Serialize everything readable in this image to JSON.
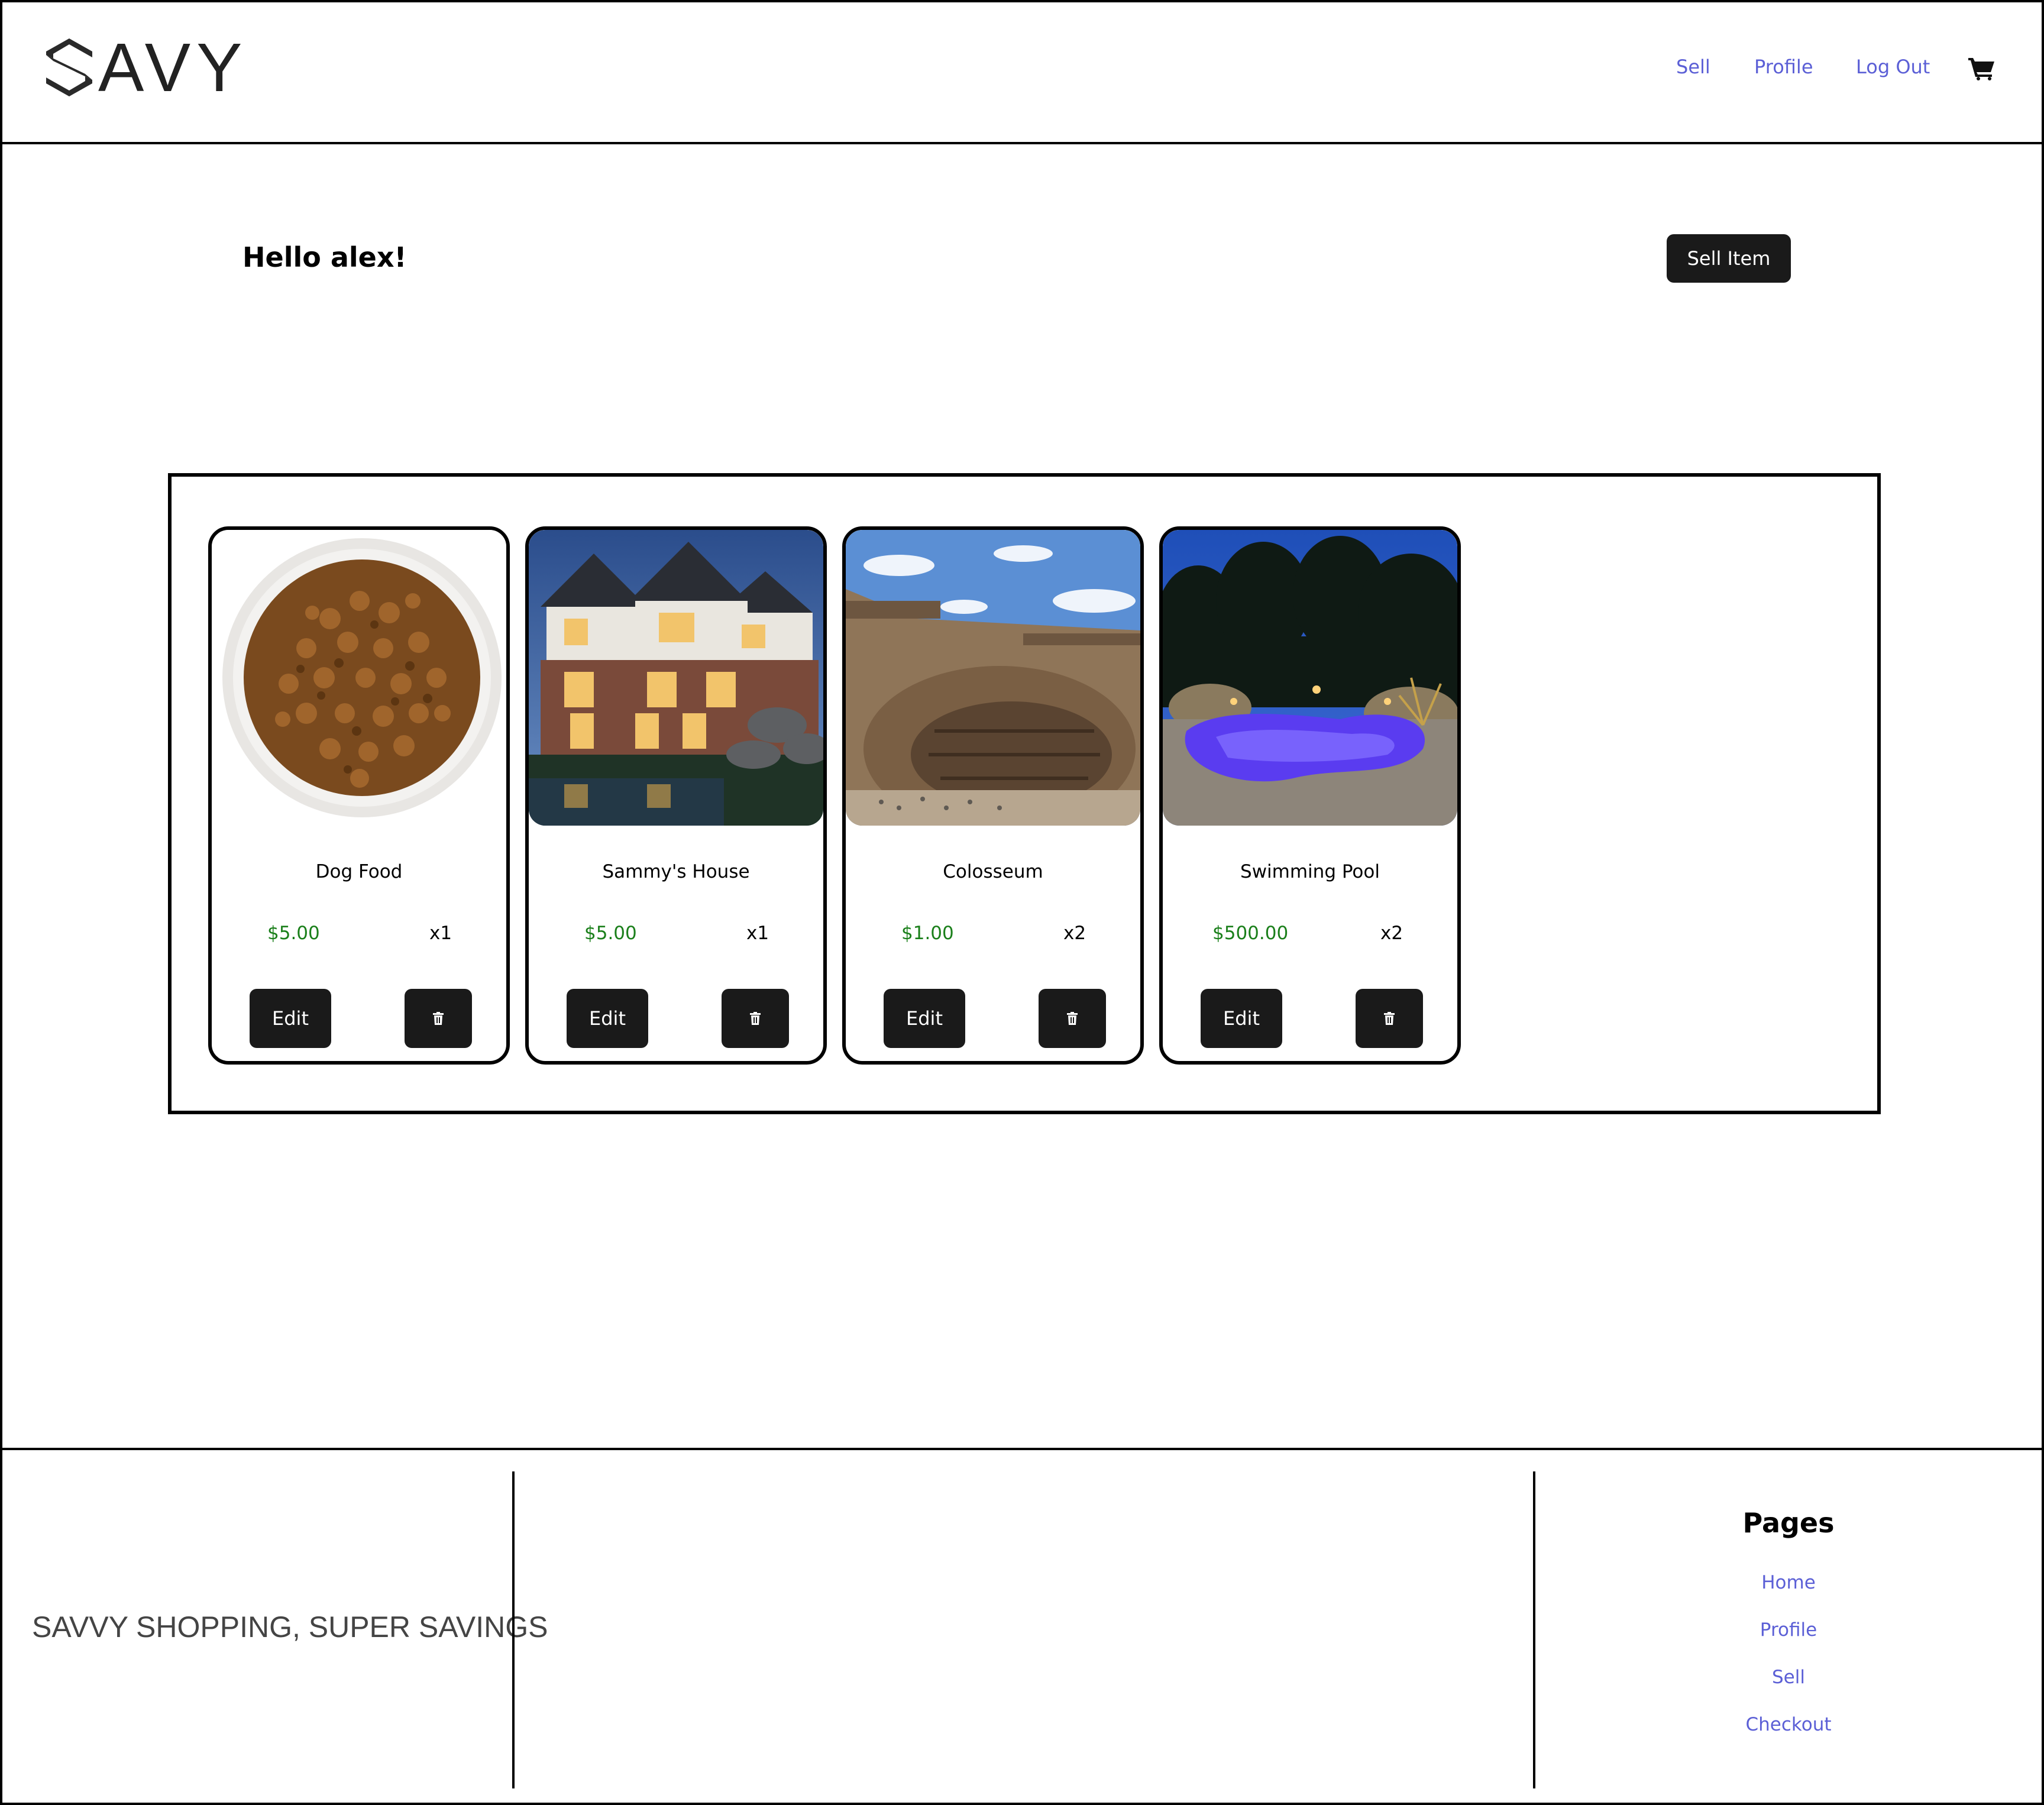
{
  "header": {
    "logo_text": "AVY",
    "nav": [
      "Sell",
      "Profile",
      "Log Out"
    ]
  },
  "main": {
    "greeting": "Hello alex!",
    "sell_item_label": "Sell Item"
  },
  "listings": [
    {
      "name": "Dog Food",
      "price": "$5.00",
      "qty": "x1",
      "image": "dog-food-bowl",
      "edit_label": "Edit"
    },
    {
      "name": "Sammy's House",
      "price": "$5.00",
      "qty": "x1",
      "image": "house-photo",
      "edit_label": "Edit"
    },
    {
      "name": "Colosseum",
      "price": "$1.00",
      "qty": "x2",
      "image": "colosseum-photo",
      "edit_label": "Edit"
    },
    {
      "name": "Swimming Pool",
      "price": "$500.00",
      "qty": "x2",
      "image": "pool-photo",
      "edit_label": "Edit"
    }
  ],
  "footer": {
    "tagline": "SAVVY SHOPPING, SUPER SAVINGS",
    "pages_title": "Pages",
    "links": [
      "Home",
      "Profile",
      "Sell",
      "Checkout"
    ]
  },
  "icons": {
    "cart": "shopping-cart-icon",
    "delete": "trash-icon"
  },
  "colors": {
    "link": "#5b5fd6",
    "price": "#1a7f1a",
    "button": "#1a1a1a"
  }
}
